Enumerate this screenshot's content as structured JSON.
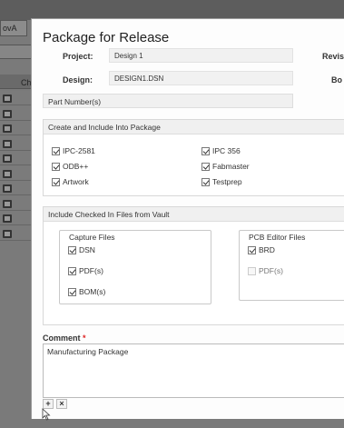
{
  "background": {
    "top_select_text": "ovA",
    "column_header": "Ch",
    "row_count": 10
  },
  "dialog": {
    "title": "Package for Release",
    "project_label": "Project:",
    "project_value": "Design 1",
    "design_label": "Design:",
    "design_value": "DESIGN1.DSN",
    "revision_label": "Revisi",
    "bom_label": "Bo"
  },
  "part_numbers": {
    "label": "Part Number(s)"
  },
  "create_include": {
    "label": "Create and Include Into Package",
    "items": [
      {
        "label": "IPC-2581",
        "checked": true
      },
      {
        "label": "ODB++",
        "checked": true
      },
      {
        "label": "Artwork",
        "checked": true
      },
      {
        "label": "IPC 356",
        "checked": true
      },
      {
        "label": "Fabmaster",
        "checked": true
      },
      {
        "label": "Testprep",
        "checked": true
      }
    ]
  },
  "vault": {
    "label": "Include Checked In Files from Vault",
    "capture": {
      "title": "Capture Files",
      "items": [
        {
          "label": "DSN",
          "checked": true
        },
        {
          "label": "PDF(s)",
          "checked": true
        },
        {
          "label": "BOM(s)",
          "checked": true
        }
      ]
    },
    "pcb": {
      "title": "PCB Editor Files",
      "items": [
        {
          "label": "BRD",
          "checked": true
        },
        {
          "label": "PDF(s)",
          "checked": false
        }
      ]
    }
  },
  "comment": {
    "label": "Comment",
    "required_mark": "*",
    "value": "Manufacturing Package"
  },
  "toolbar": {
    "add_label": "+",
    "remove_label": "×"
  }
}
